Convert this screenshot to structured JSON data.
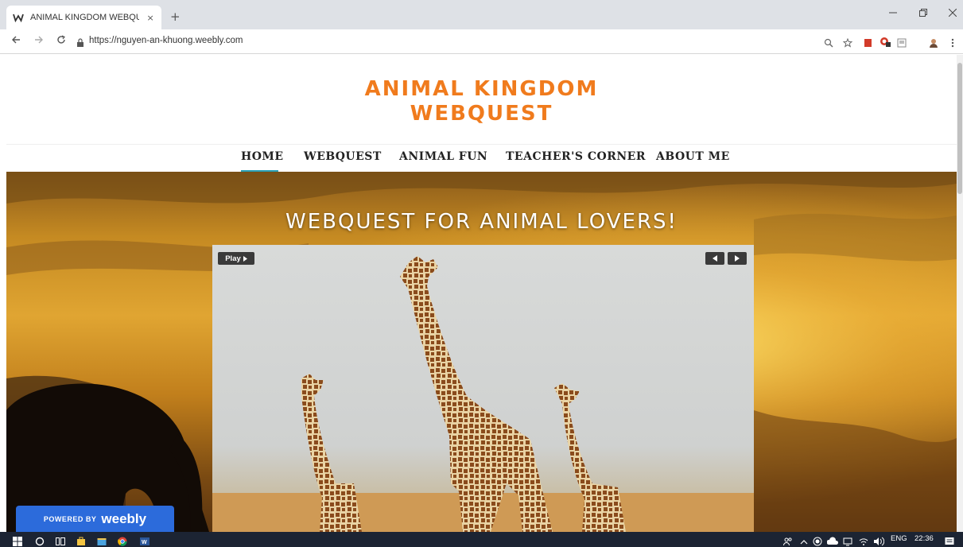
{
  "browser": {
    "tab_title": "ANIMAL KINGDOM WEBQUEST",
    "tab_close": "×",
    "new_tab": "+",
    "url": "https://nguyen-an-khuong.weebly.com"
  },
  "site": {
    "title_line1": "ANIMAL KINGDOM",
    "title_line2": "WEBQUEST",
    "title_color": "#f07b1d",
    "nav": [
      {
        "label": "HOME",
        "active": true
      },
      {
        "label": "WEBQUEST"
      },
      {
        "label": "ANIMAL FUN"
      },
      {
        "label": "TEACHER'S CORNER"
      },
      {
        "label": "ABOUT ME"
      }
    ],
    "accent_color": "#2aa1b6",
    "hero_title": "WEBQUEST FOR ANIMAL LOVERS!",
    "slideshow": {
      "play_label": "Play",
      "prev_icon": "prev-arrow-icon",
      "next_icon": "next-arrow-icon"
    },
    "badge": {
      "powered_by": "POWERED BY",
      "brand": "weebly",
      "color": "#2c6bdb"
    }
  },
  "taskbar": {
    "language": "ENG",
    "time": "22:36"
  }
}
